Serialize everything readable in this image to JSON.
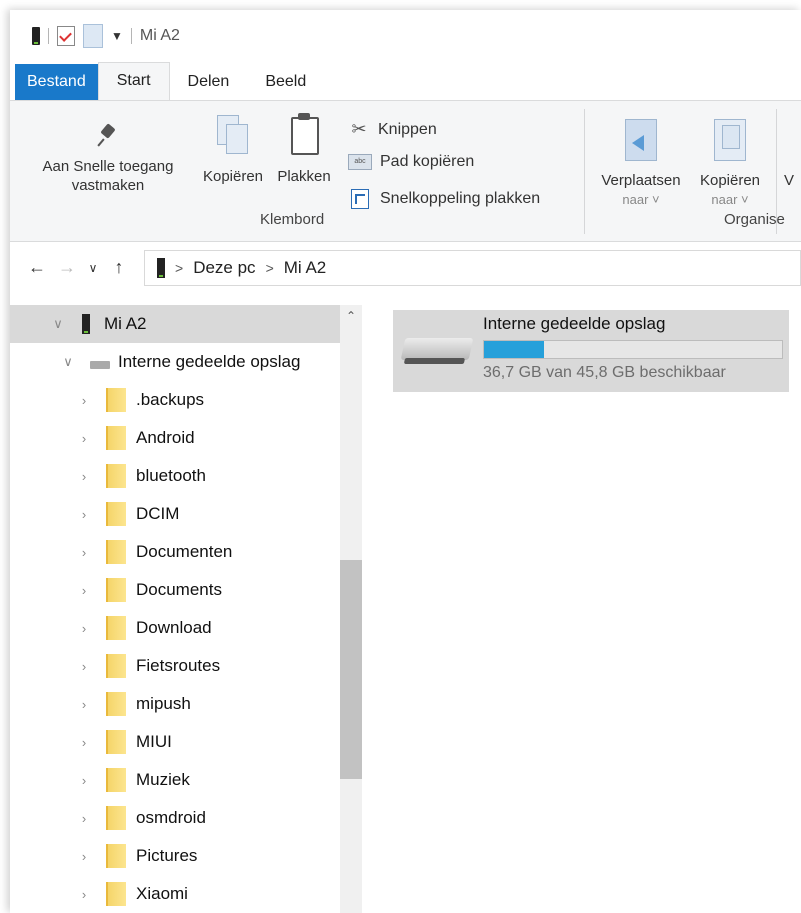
{
  "title_bar": {
    "title": "Mi A2"
  },
  "tabs": [
    "Bestand",
    "Start",
    "Delen",
    "Beeld"
  ],
  "ribbon": {
    "pin": {
      "line1": "Aan Snelle toegang",
      "line2": "vastmaken"
    },
    "copy": "Kopiëren",
    "paste": "Plakken",
    "cut": "Knippen",
    "copy_path": "Pad kopiëren",
    "paste_shortcut": "Snelkoppeling plakken",
    "clipboard_group": "Klembord",
    "move_to": {
      "line1": "Verplaatsen",
      "line2": "naar"
    },
    "copy_to": {
      "line1": "Kopiëren",
      "line2": "naar"
    },
    "next_btn_letter": "V",
    "organize_group": "Organise"
  },
  "address": {
    "crumbs": [
      "Deze pc",
      "Mi A2"
    ]
  },
  "nav": {
    "root": "Mi A2",
    "storage": "Interne gedeelde opslag",
    "folders": [
      ".backups",
      "Android",
      "bluetooth",
      "DCIM",
      "Documenten",
      "Documents",
      "Download",
      "Fietsroutes",
      "mipush",
      "MIUI",
      "Muziek",
      "osmdroid",
      "Pictures",
      "Xiaomi"
    ],
    "scroll": {
      "thumb_start": 0.42,
      "thumb_end": 0.78
    }
  },
  "content": {
    "drive_name": "Interne gedeelde opslag",
    "free_space_text": "36,7 GB van 45,8 GB beschikbaar",
    "used_fraction": 0.2
  },
  "colors": {
    "accent": "#1979ca",
    "usage_bar": "#26a0da",
    "folder": "#fce58f"
  }
}
